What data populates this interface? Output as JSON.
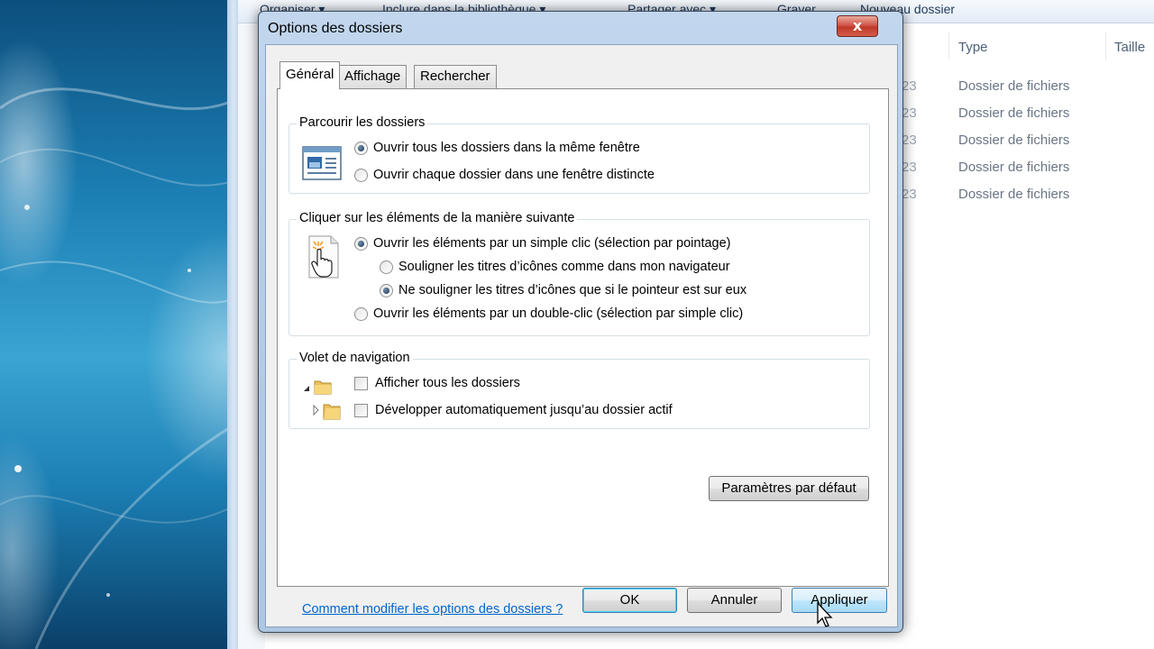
{
  "explorer": {
    "toolbar": {
      "organize": "Organiser ▾",
      "include_library": "Inclure dans la bibliothèque ▾",
      "share_with": "Partager avec ▾",
      "burn": "Graver",
      "new_folder": "Nouveau dossier"
    },
    "columns": {
      "type": "Type",
      "size": "Taille"
    },
    "rows": [
      {
        "date": "23",
        "type": "Dossier de fichiers"
      },
      {
        "date": "23",
        "type": "Dossier de fichiers"
      },
      {
        "date": "23",
        "type": "Dossier de fichiers"
      },
      {
        "date": "23",
        "type": "Dossier de fichiers"
      },
      {
        "date": "23",
        "type": "Dossier de fichiers"
      }
    ]
  },
  "dialog": {
    "title": "Options des dossiers",
    "close_label": "x",
    "tabs": [
      {
        "label": "Général",
        "active": true
      },
      {
        "label": "Affichage",
        "active": false
      },
      {
        "label": "Rechercher",
        "active": false
      }
    ],
    "browse": {
      "title": "Parcourir les dossiers",
      "same_window": "Ouvrir tous les dossiers dans la même fenêtre",
      "separate_window": "Ouvrir chaque dossier dans une fenêtre distincte",
      "selected": "same_window"
    },
    "click": {
      "title": "Cliquer sur les éléments de la manière suivante",
      "single_click": "Ouvrir les éléments par un simple clic (sélection par pointage)",
      "underline_always": "Souligner les titres d’icônes comme dans mon navigateur",
      "underline_hover": "Ne souligner les titres d’icônes que si le pointeur est sur eux",
      "double_click": "Ouvrir les éléments par un double-clic (sélection par simple clic)",
      "selected": "single_click",
      "underline_selected": "underline_hover"
    },
    "nav_pane": {
      "title": "Volet de navigation",
      "show_all_folders": "Afficher tous les dossiers",
      "auto_expand": "Développer automatiquement jusqu’au dossier actif",
      "show_all_checked": false,
      "auto_expand_checked": false
    },
    "restore_defaults": "Paramètres par défaut",
    "help_link": "Comment modifier les options des dossiers ?",
    "buttons": {
      "ok": "OK",
      "cancel": "Annuler",
      "apply": "Appliquer"
    }
  }
}
